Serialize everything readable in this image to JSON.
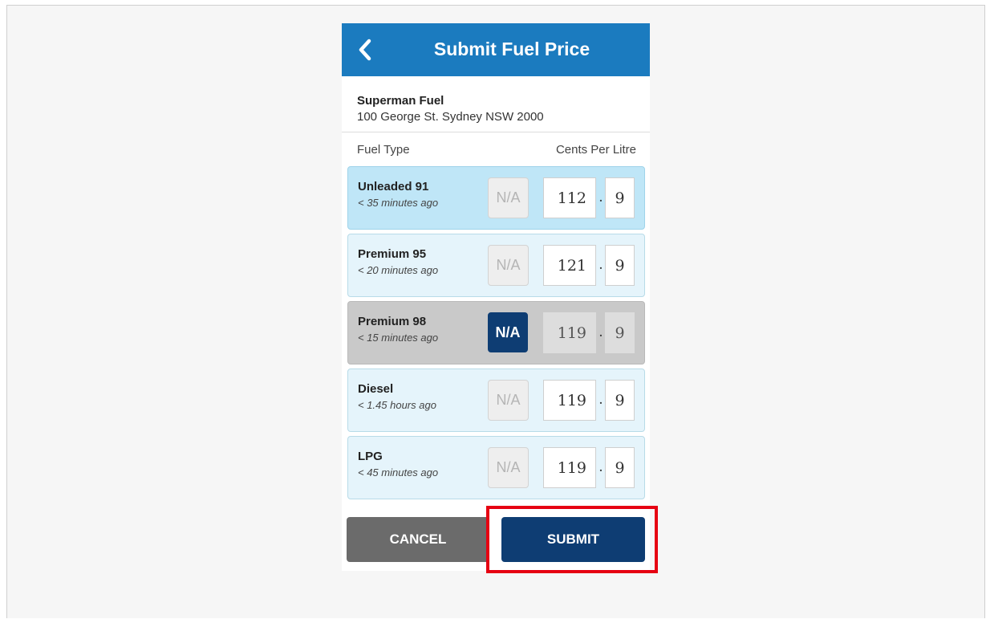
{
  "header": {
    "title": "Submit Fuel Price",
    "back_icon": "chevron-left-icon"
  },
  "station": {
    "name": "Superman Fuel",
    "address": "100 George St. Sydney NSW 2000"
  },
  "columns": {
    "left": "Fuel Type",
    "right": "Cents Per Litre"
  },
  "fuels": [
    {
      "name": "Unleaded 91",
      "updated": "< 35 minutes ago",
      "na_label": "N/A",
      "price_int": "112",
      "price_dec": "9",
      "state": "selected"
    },
    {
      "name": "Premium 95",
      "updated": "< 20 minutes ago",
      "na_label": "N/A",
      "price_int": "121",
      "price_dec": "9",
      "state": "normal"
    },
    {
      "name": "Premium 98",
      "updated": "< 15 minutes ago",
      "na_label": "N/A",
      "price_int": "119",
      "price_dec": "9",
      "state": "not-available"
    },
    {
      "name": "Diesel",
      "updated": "< 1.45 hours ago",
      "na_label": "N/A",
      "price_int": "119",
      "price_dec": "9",
      "state": "normal"
    },
    {
      "name": "LPG",
      "updated": "< 45 minutes ago",
      "na_label": "N/A",
      "price_int": "119",
      "price_dec": "9",
      "state": "normal"
    }
  ],
  "decimal_separator": ".",
  "actions": {
    "cancel_label": "CANCEL",
    "submit_label": "SUBMIT"
  },
  "colors": {
    "header_blue": "#1b7bbf",
    "submit_navy": "#0e3d73",
    "cancel_grey": "#6b6b6b",
    "highlight_red": "#e60012"
  }
}
